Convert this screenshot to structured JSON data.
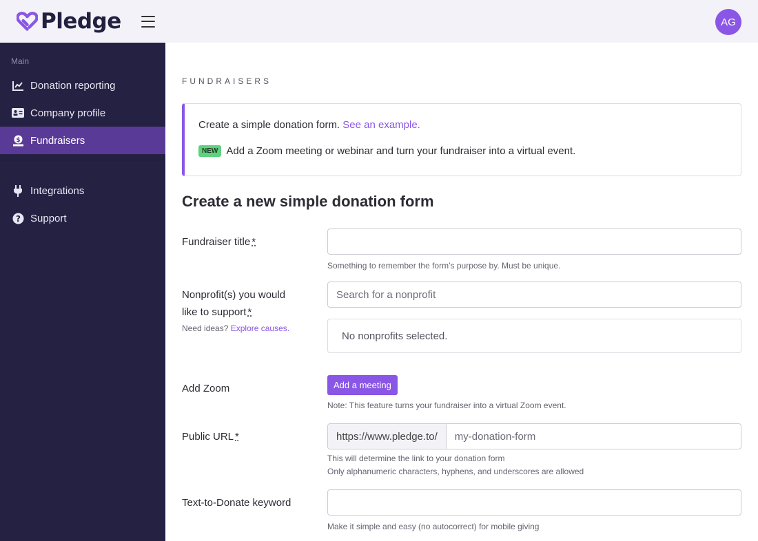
{
  "header": {
    "brand": "Pledge",
    "avatar_initials": "AG",
    "accent_color": "#8a56e6"
  },
  "sidebar": {
    "section_label": "Main",
    "items": [
      {
        "label": "Donation reporting",
        "icon": "chart-line-icon",
        "active": false
      },
      {
        "label": "Company profile",
        "icon": "id-card-icon",
        "active": false
      },
      {
        "label": "Fundraisers",
        "icon": "donate-icon",
        "active": true
      },
      {
        "label": "Integrations",
        "icon": "plug-icon",
        "active": false
      },
      {
        "label": "Support",
        "icon": "question-circle-icon",
        "active": false
      }
    ]
  },
  "main": {
    "eyebrow": "FUNDRAISERS",
    "callout": {
      "text": "Create a simple donation form.",
      "link": "See an example.",
      "badge": "NEW",
      "announcement": "Add a Zoom meeting or webinar and turn your fundraiser into a virtual event."
    },
    "form_title": "Create a new simple donation form",
    "fields": {
      "title": {
        "label": "Fundraiser title",
        "required": "*",
        "value": "",
        "help": "Something to remember the form’s purpose by. Must be unique."
      },
      "nonprofits": {
        "label_line1": "Nonprofit(s) you would",
        "label_line2": "like to support",
        "required": "*",
        "help_prefix": "Need ideas?",
        "help_link": "Explore causes.",
        "placeholder": "Search for a nonprofit",
        "empty_text": "No nonprofits selected."
      },
      "zoom": {
        "label": "Add Zoom",
        "button": "Add a meeting",
        "help": "Note: This feature turns your fundraiser into a virtual Zoom event."
      },
      "url": {
        "label": "Public URL",
        "required": "*",
        "prefix": "https://www.pledge.to/",
        "placeholder": "my-donation-form",
        "help_line1": "This will determine the link to your donation form",
        "help_line2": "Only alphanumeric characters, hyphens, and underscores are allowed"
      },
      "keyword": {
        "label": "Text-to-Donate keyword",
        "value": "",
        "help": "Make it simple and easy (no autocorrect) for mobile giving"
      }
    }
  }
}
